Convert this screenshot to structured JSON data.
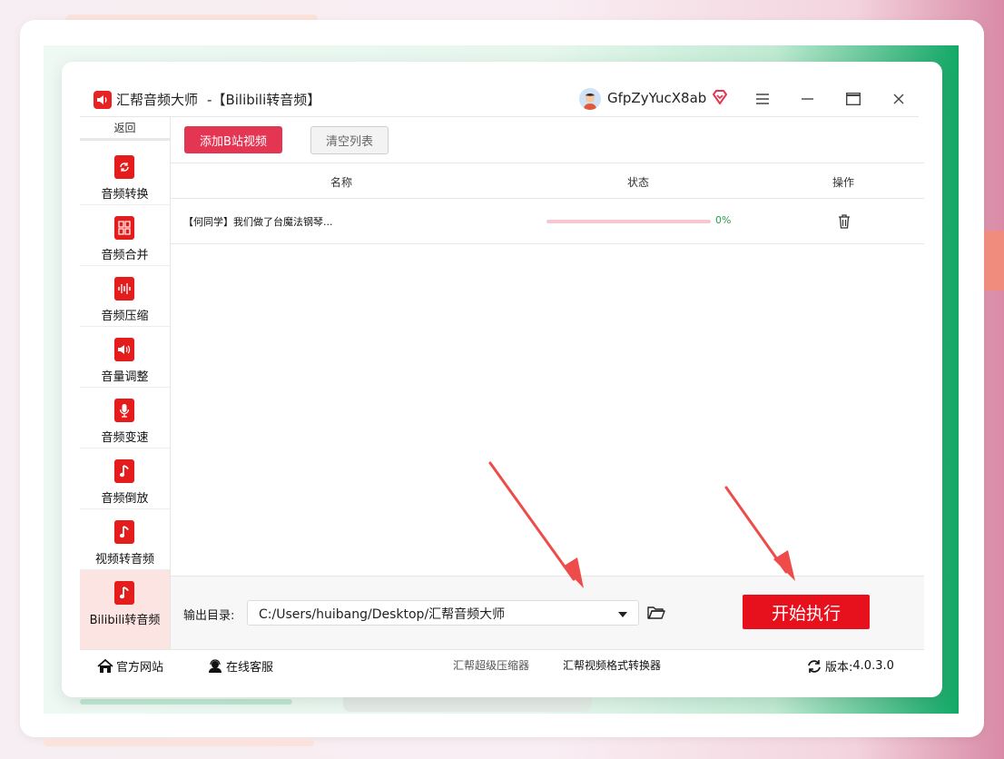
{
  "window": {
    "app_name": "汇帮音频大师",
    "separator": "-",
    "module": "【Bilibili转音频】",
    "username": "GfpZyYucX8ab"
  },
  "sidebar": {
    "back_label": "返回",
    "items": [
      {
        "label": "音频转换",
        "icon": "audio-convert-icon"
      },
      {
        "label": "音频合并",
        "icon": "audio-merge-icon"
      },
      {
        "label": "音频压缩",
        "icon": "audio-compress-icon"
      },
      {
        "label": "音量调整",
        "icon": "volume-adjust-icon"
      },
      {
        "label": "音频变速",
        "icon": "audio-speed-icon"
      },
      {
        "label": "音频倒放",
        "icon": "audio-reverse-icon"
      },
      {
        "label": "视频转音频",
        "icon": "video-to-audio-icon"
      },
      {
        "label": "Bilibili转音频",
        "icon": "bilibili-to-audio-icon",
        "active": true
      }
    ]
  },
  "toolbar": {
    "add_label": "添加B站视频",
    "clear_label": "清空列表"
  },
  "table": {
    "headers": {
      "name": "名称",
      "status": "状态",
      "action": "操作"
    },
    "rows": [
      {
        "name": "【何同学】我们做了台魔法钢琴...",
        "status": "0%",
        "progress": 0
      }
    ]
  },
  "output": {
    "label": "输出目录:",
    "path": "C:/Users/huibang/Desktop/汇帮音频大师",
    "start_label": "开始执行"
  },
  "footer": {
    "website": "官方网站",
    "support": "在线客服",
    "link1": "汇帮超级压缩器",
    "link2": "汇帮视频格式转换器",
    "version_label": "版本:",
    "version": "4.0.3.0"
  },
  "colors": {
    "accent": "#e43553",
    "start_button": "#e7111d",
    "icon_red": "#e51c1c",
    "active_bg": "#fce4e2",
    "status_green": "#2aa14a",
    "annotation_arrow": "#ee4b4b"
  }
}
